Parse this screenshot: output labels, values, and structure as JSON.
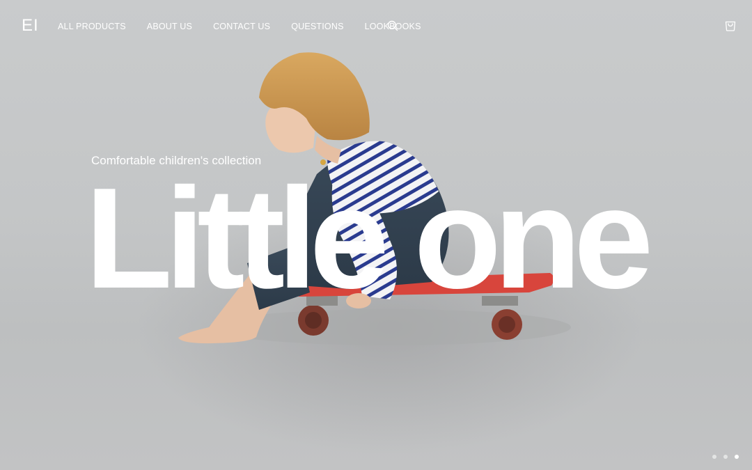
{
  "header": {
    "logo": "EI",
    "nav": [
      {
        "label": "ALL PRODUCTS"
      },
      {
        "label": "ABOUT US"
      },
      {
        "label": "CONTACT US"
      },
      {
        "label": "QUESTIONS"
      },
      {
        "label": "LOOKBOOKS"
      }
    ],
    "search_icon": "search-icon",
    "cart_icon": "shopping-bag-icon"
  },
  "hero": {
    "subtitle": "Comfortable children's collection",
    "headline": "Little one",
    "image": "child-on-skateboard-photo"
  },
  "carousel": {
    "slides": 3,
    "active_index": 2
  },
  "colors": {
    "text": "#ffffff",
    "background": "#c4c6c7",
    "skateboard": "#d8453c",
    "stripe": "#2a3b8f"
  }
}
